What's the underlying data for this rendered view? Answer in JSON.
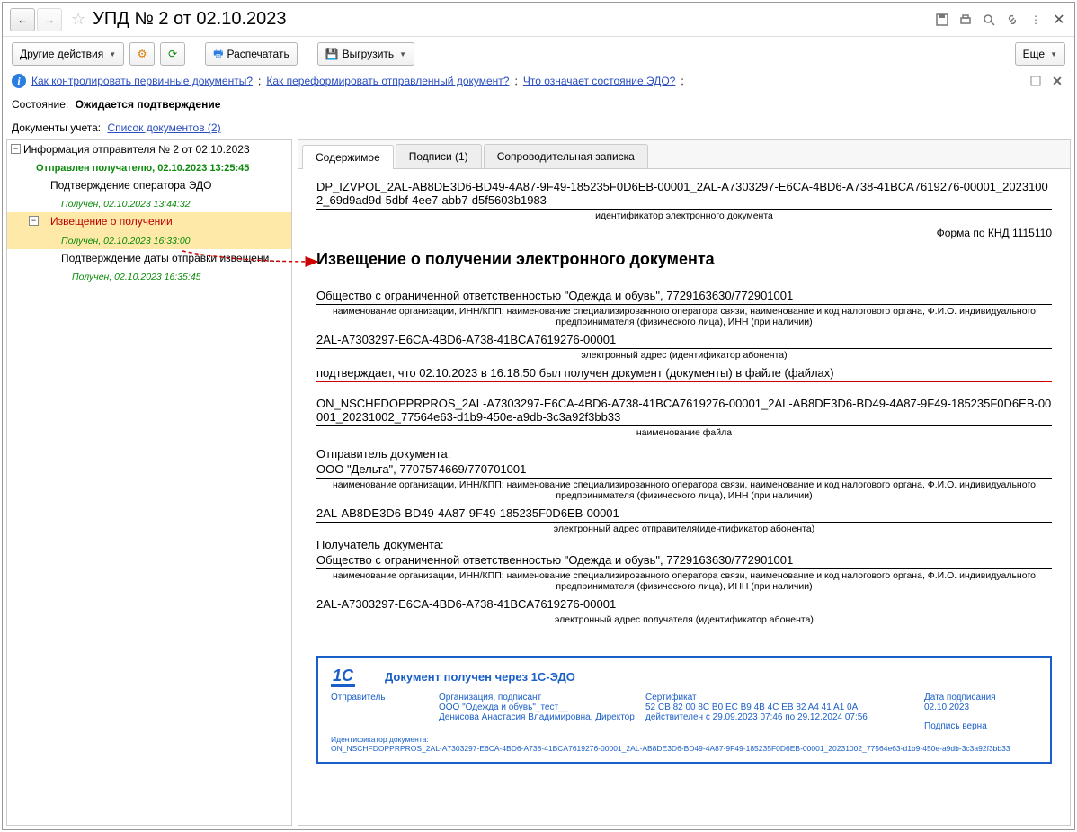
{
  "title": "УПД № 2 от 02.10.2023",
  "toolbar": {
    "other_actions": "Другие действия",
    "print": "Распечатать",
    "export": "Выгрузить",
    "more": "Еще"
  },
  "info_links": {
    "l1": "Как контролировать первичные документы?",
    "l2": "Как переформировать отправленный документ?",
    "l3": "Что означает состояние ЭДО?"
  },
  "sep": ";",
  "status": {
    "label": "Состояние:",
    "value": "Ожидается подтверждение"
  },
  "docs": {
    "label": "Документы учета:",
    "link": "Список документов (2)"
  },
  "tree": {
    "root": "Информация отправителя № 2 от 02.10.2023",
    "sent": "Отправлен получателю, 02.10.2023 13:25:45",
    "item1": "Подтверждение оператора ЭДО",
    "item1_status": "Получен, 02.10.2023 13:44:32",
    "item2": "Извещение о получении",
    "item2_status": "Получен, 02.10.2023 16:33:00",
    "item3": "Подтверждение даты отправки извещени...",
    "item3_status": "Получен, 02.10.2023 16:35:45"
  },
  "tabs": {
    "content": "Содержимое",
    "signatures": "Подписи (1)",
    "note": "Сопроводительная записка"
  },
  "doc": {
    "id": "DP_IZVPOL_2AL-AB8DE3D6-BD49-4A87-9F49-185235F0D6EB-00001_2AL-A7303297-E6CA-4BD6-A738-41BCA7619276-00001_20231002_69d9ad9d-5dbf-4ee7-abb7-d5f5603b1983",
    "id_caption": "идентификатор электронного документа",
    "form": "Форма по КНД 1115110",
    "title": "Извещение о получении электронного документа",
    "org1": "Общество с ограниченной ответственностью \"Одежда и обувь\", 7729163630/772901001",
    "org_caption": "наименование организации, ИНН/КПП; наименование специализированного оператора связи, наименование и код налогового органа, Ф.И.О. индивидуального предпринимателя (физического лица), ИНН (при наличии)",
    "addr1": "2AL-A7303297-E6CA-4BD6-A738-41BCA7619276-00001",
    "addr1_caption": "электронный адрес (идентификатор абонента)",
    "confirm": "подтверждает, что 02.10.2023 в 16.18.50 был получен документ (документы) в файле (файлах)",
    "file": "ON_NSCHFDOPPRPROS_2AL-A7303297-E6CA-4BD6-A738-41BCA7619276-00001_2AL-AB8DE3D6-BD49-4A87-9F49-185235F0D6EB-00001_20231002_77564e63-d1b9-450e-a9db-3c3a92f3bb33",
    "file_caption": "наименование файла",
    "sender_label": "Отправитель документа:",
    "sender": "ООО \"Дельта\", 7707574669/770701001",
    "sender_addr": "2AL-AB8DE3D6-BD49-4A87-9F49-185235F0D6EB-00001",
    "sender_addr_caption": "электронный адрес отправителя(идентификатор абонента)",
    "receiver_label": "Получатель документа:",
    "receiver": "Общество с ограниченной ответственностью \"Одежда и обувь\", 7729163630/772901001",
    "receiver_addr": "2AL-A7303297-E6CA-4BD6-A738-41BCA7619276-00001",
    "receiver_addr_caption": "электронный адрес получателя (идентификатор абонента)"
  },
  "sig": {
    "logo": "1C",
    "title": "Документ получен через 1С-ЭДО",
    "col1_label": "Отправитель",
    "col2_label": "Организация, подписант",
    "col2_value": "ООО \"Одежда и обувь\"_тест__\nДенисова Анастасия Владимировна, Директор",
    "col3_label": "Сертификат",
    "col3_value": "52 CB 82 00 8C B0 EC B9 4B 4C EB 82 A4 41 A1 0A\nдействителен с 29.09.2023 07:46 по 29.12.2024 07:56",
    "col4_label": "Дата подписания",
    "col4_value": "02.10.2023",
    "col4_status": "Подпись верна",
    "id_label": "Идентификатор документа:",
    "id_value": "ON_NSCHFDOPPRPROS_2AL-A7303297-E6CA-4BD6-A738-41BCA7619276-00001_2AL-AB8DE3D6-BD49-4A87-9F49-185235F0D6EB-00001_20231002_77564e63-d1b9-450e-a9db-3c3a92f3bb33"
  }
}
